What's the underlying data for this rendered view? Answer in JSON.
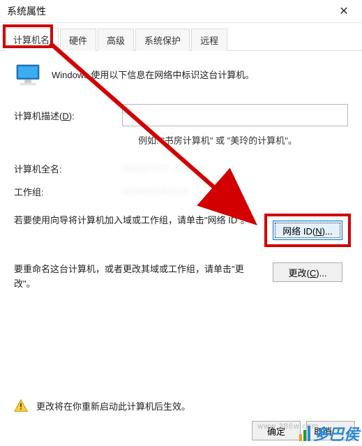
{
  "window": {
    "title": "系统属性",
    "close_icon": "✕"
  },
  "tabs": [
    {
      "label": "计算机名",
      "active": true
    },
    {
      "label": "硬件",
      "active": false
    },
    {
      "label": "高级",
      "active": false
    },
    {
      "label": "系统保护",
      "active": false
    },
    {
      "label": "远程",
      "active": false
    }
  ],
  "intro": {
    "text": "Windows 使用以下信息在网络中标识这台计算机。"
  },
  "description": {
    "label_prefix": "计算机描述(",
    "label_key": "D",
    "label_suffix": "):",
    "value": "",
    "hint": "例如: \"书房计算机\" 或 \"美玲的计算机\"。"
  },
  "info": {
    "fullname_label": "计算机全名:",
    "fullname_value": "DESKTOP-XXXXX",
    "workgroup_label": "工作组:",
    "workgroup_value": "WORKGROUP"
  },
  "netid": {
    "desc": "若要使用向导将计算机加入域或工作组，请单击\"网络 ID\"。",
    "button_prefix": "网络 ID(",
    "button_key": "N",
    "button_suffix": ")..."
  },
  "change": {
    "desc": "要重命名这台计算机，或者更改其域或工作组，请单击\"更改\"。",
    "button_prefix": "更改(",
    "button_key": "C",
    "button_suffix": ")..."
  },
  "footer": {
    "notice": "更改将在你重新启动此计算机后生效。"
  },
  "buttons": {
    "ok": "确定",
    "cancel": "取消"
  },
  "watermark": {
    "text": "多巴侯",
    "url": "www.386w.com"
  }
}
